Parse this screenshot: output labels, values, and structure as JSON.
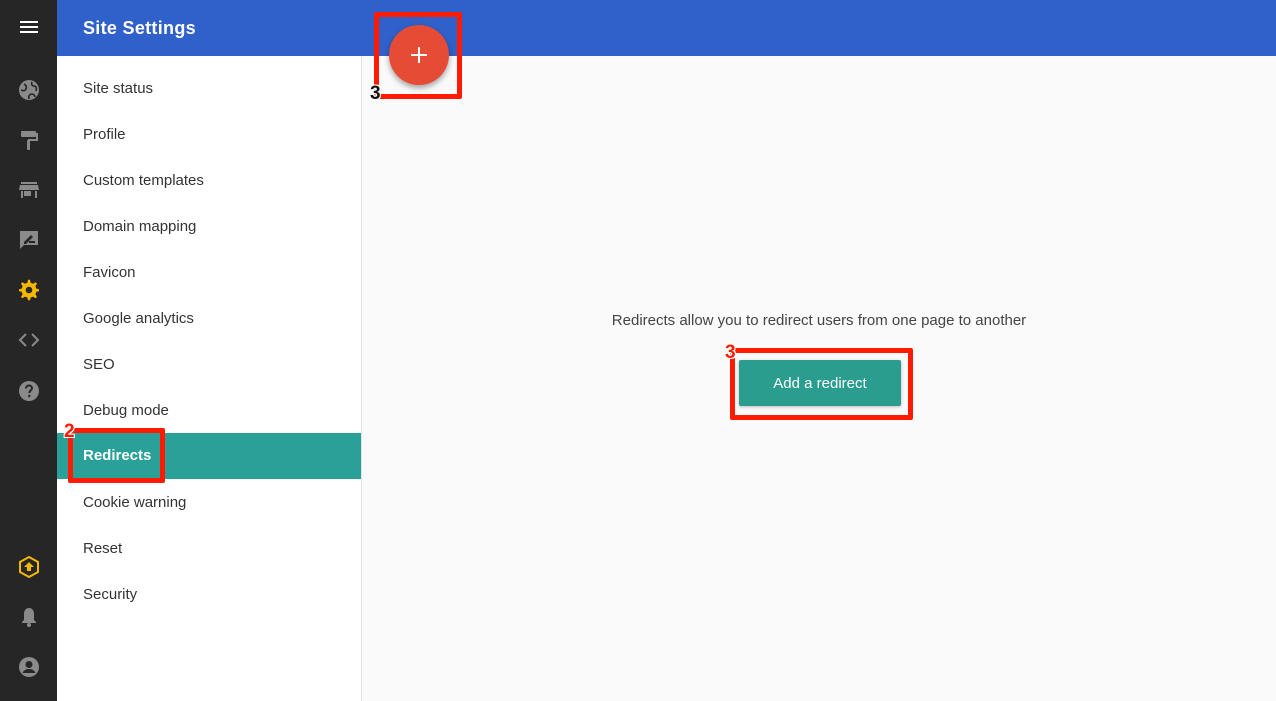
{
  "header": {
    "title": "Site Settings"
  },
  "rail": {
    "items": [
      {
        "icon": "menu-icon"
      },
      {
        "icon": "globe-icon"
      },
      {
        "icon": "paint-roller-icon"
      },
      {
        "icon": "store-icon"
      },
      {
        "icon": "edit-note-icon"
      },
      {
        "icon": "gear-icon",
        "active": true
      },
      {
        "icon": "code-icon"
      },
      {
        "icon": "help-icon"
      },
      {
        "icon": "upgrade-icon"
      },
      {
        "icon": "bell-icon"
      },
      {
        "icon": "account-icon"
      }
    ],
    "active_color": "#f5b800"
  },
  "nav": {
    "items": [
      {
        "label": "Site status"
      },
      {
        "label": "Profile"
      },
      {
        "label": "Custom templates"
      },
      {
        "label": "Domain mapping"
      },
      {
        "label": "Favicon"
      },
      {
        "label": "Google analytics"
      },
      {
        "label": "SEO"
      },
      {
        "label": "Debug mode"
      },
      {
        "label": "Redirects",
        "active": true
      },
      {
        "label": "Cookie warning"
      },
      {
        "label": "Reset"
      },
      {
        "label": "Security"
      }
    ],
    "active_color": "#2aa198"
  },
  "main": {
    "empty_text": "Redirects allow you to redirect users from one page to another",
    "add_button_label": "Add a redirect",
    "fab_icon": "plus-icon"
  },
  "annotations": [
    {
      "label": "2"
    },
    {
      "label": "3"
    },
    {
      "label": "3"
    }
  ],
  "colors": {
    "header": "#3060c9",
    "rail": "#262626",
    "fab": "#e54b35",
    "primary_button": "#2a9d8f",
    "annotation": "#ff1a00"
  }
}
